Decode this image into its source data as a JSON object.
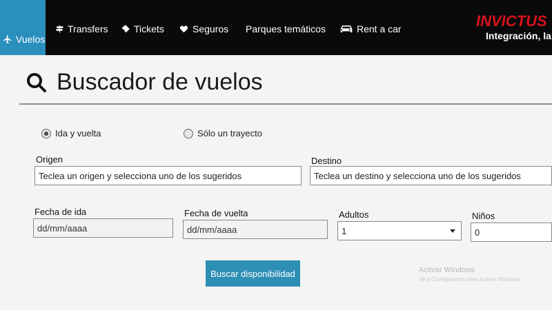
{
  "nav": {
    "items": [
      {
        "label": "Vuelos",
        "icon": "plane-icon",
        "active": true
      },
      {
        "label": "Transfers",
        "icon": "signpost-icon"
      },
      {
        "label": "Tickets",
        "icon": "ticket-icon"
      },
      {
        "label": "Seguros",
        "icon": "heart-shield-icon"
      },
      {
        "label": "Parques temáticos",
        "icon": ""
      },
      {
        "label": "Rent a car",
        "icon": "car-icon"
      }
    ],
    "brand": "INVICTUS",
    "tagline": "Integración, la s"
  },
  "search": {
    "title": "Buscador de vuelos",
    "trip_type": {
      "options": [
        "Ida y vuelta",
        "Sólo un trayecto"
      ],
      "selected": "Ida y vuelta"
    },
    "origin": {
      "label": "Origen",
      "placeholder": "Teclea un origen y selecciona uno de los sugeridos"
    },
    "destination": {
      "label": "Destino",
      "placeholder": "Teclea un destino y selecciona uno de los sugeridos"
    },
    "departure_date": {
      "label": "Fecha de ida",
      "placeholder": "dd/mm/aaaa"
    },
    "return_date": {
      "label": "Fecha de vuelta",
      "placeholder": "dd/mm/aaaa"
    },
    "adults": {
      "label": "Adultos",
      "value": "1"
    },
    "children": {
      "label": "Niños",
      "value": "0"
    },
    "submit_label": "Buscar disponibilidad"
  },
  "watermark": {
    "line1": "Activar Windows",
    "line2": "Ve a Configuración para activar Windows."
  },
  "colors": {
    "accent": "#2e8fb5",
    "brand": "#d8111b",
    "nav_bg": "#0a0a0a"
  }
}
